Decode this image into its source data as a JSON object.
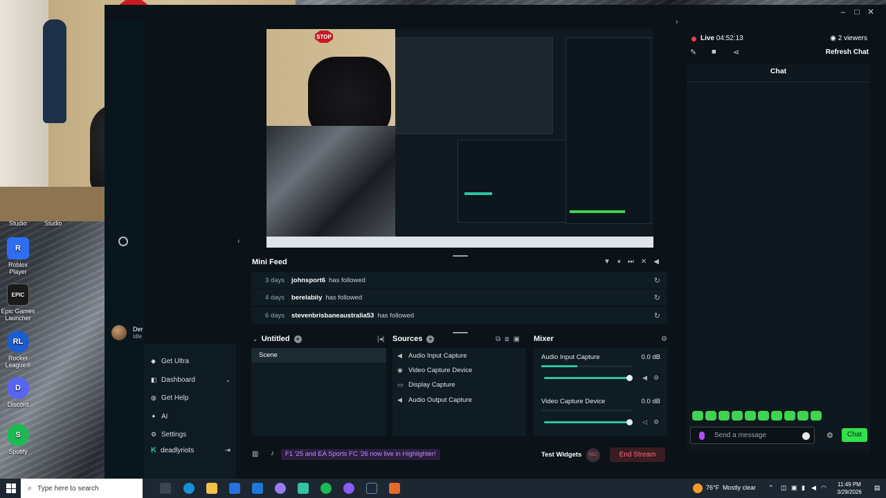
{
  "camera": {
    "stop_sign": "STOP",
    "label_left": "Studio",
    "label_right": "Studio"
  },
  "desktop_icons": [
    {
      "name": "roblox-player-icon",
      "label": "Roblox Player",
      "color": "#2f6df2",
      "glyph": "R"
    },
    {
      "name": "epic-games-icon",
      "label": "Epic Games Launcher",
      "color": "#1b1b1b",
      "glyph": "EPIC"
    },
    {
      "name": "rocket-league-icon",
      "label": "Rocket League®",
      "color": "#1d5ccf",
      "glyph": "RL"
    },
    {
      "name": "discord-icon",
      "label": "Discord",
      "color": "#5865f2",
      "glyph": "D"
    },
    {
      "name": "spotify-icon",
      "label": "Spotify",
      "color": "#1db954",
      "glyph": "S"
    }
  ],
  "profile": {
    "name": "Der",
    "status": "Idle"
  },
  "menu": {
    "items": [
      {
        "label": "Get Ultra",
        "icon": "ultra-icon"
      },
      {
        "label": "Dashboard",
        "icon": "dashboard-icon"
      },
      {
        "label": "Get Help",
        "icon": "help-icon"
      },
      {
        "label": "AI",
        "icon": "ai-icon"
      },
      {
        "label": "Settings",
        "icon": "gear-icon"
      }
    ],
    "user": "deadlyriots"
  },
  "mini_feed": {
    "title": "Mini Feed",
    "rows": [
      {
        "time": "3 days",
        "name": "johnsport6",
        "action": "has followed"
      },
      {
        "time": "4 days",
        "name": "berelabiiy",
        "action": "has followed"
      },
      {
        "time": "6 days",
        "name": "stevenbrisbaneaustralia53",
        "action": "has followed"
      }
    ]
  },
  "scenes": {
    "title": "Untitled",
    "items": [
      "Scene"
    ]
  },
  "sources": {
    "title": "Sources",
    "items": [
      {
        "label": "Audio Input Capture",
        "icon": "speaker-icon"
      },
      {
        "label": "Video Capture Device",
        "icon": "camera-icon"
      },
      {
        "label": "Display Capture",
        "icon": "monitor-icon"
      },
      {
        "label": "Audio Output Capture",
        "icon": "speaker-icon"
      }
    ]
  },
  "mixer": {
    "title": "Mixer",
    "channels": [
      {
        "name": "Audio Input Capture",
        "db": "0.0 dB",
        "level": 0.4
      },
      {
        "name": "Video Capture Device",
        "db": "0.0 dB",
        "level": 0
      }
    ]
  },
  "bottom_bar": {
    "promo": "F1 '25 and EA Sports FC '26 now live in Highlighter!",
    "test_widgets": "Test Widgets",
    "rec": "REC",
    "end_stream": "End Stream"
  },
  "chat": {
    "live_label": "Live",
    "live_time": "04:52:13",
    "viewers": "2 viewers",
    "refresh": "Refresh Chat",
    "title": "Chat",
    "placeholder": "Send a message",
    "send": "Chat"
  },
  "taskbar": {
    "search_placeholder": "Type here to search",
    "weather": "76°F",
    "weather_desc": "Mostly clear",
    "time": "11:49 PM",
    "date": "3/29/2026"
  },
  "colors": {
    "accent": "#31c3a2",
    "live": "#ff3b47",
    "chat_button": "#31e14b",
    "end_stream": "#ff6b74"
  }
}
